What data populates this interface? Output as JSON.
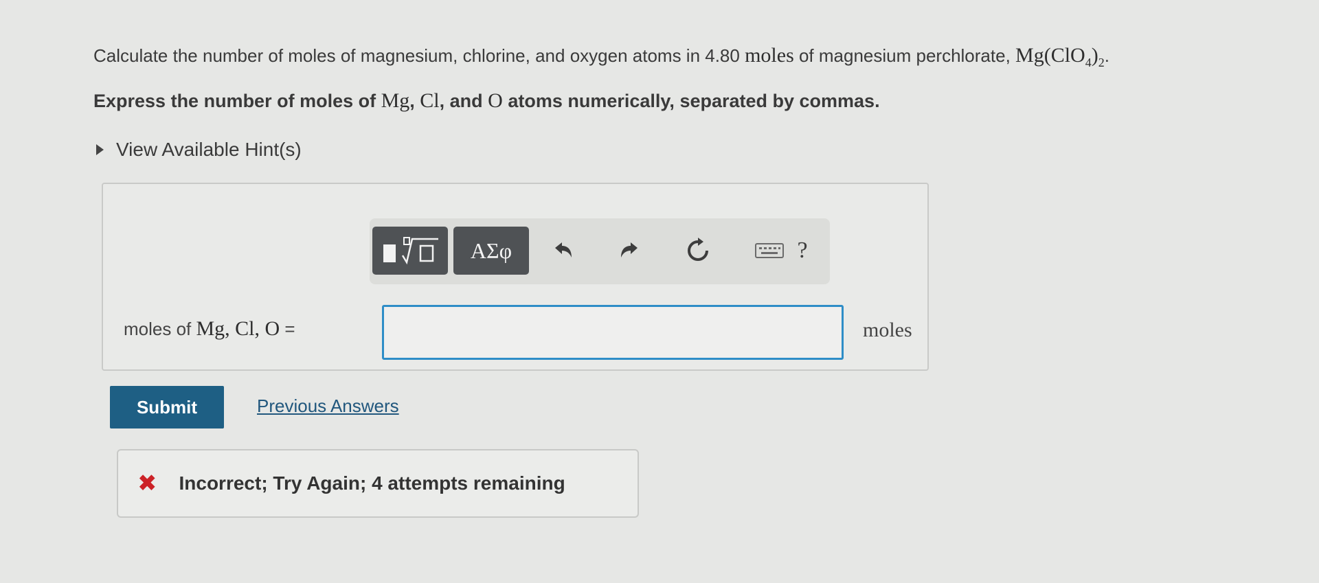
{
  "question": {
    "text": "Calculate the number of moles of magnesium, chlorine, and oxygen atoms in 4.80 ",
    "moles_unit": "moles",
    "text2": " of magnesium perchlorate, ",
    "formula_main": "Mg(ClO",
    "formula_sub4": "4",
    "formula_close": ")",
    "formula_sub2": "2",
    "end": "."
  },
  "instruction": {
    "part1": "Express the number of moles of ",
    "mg": "Mg",
    "sep1": ", ",
    "cl": "Cl",
    "sep2": ", and ",
    "o": "O",
    "part2": " atoms numerically, separated by commas."
  },
  "hint": {
    "label": "View Available Hint(s)"
  },
  "toolbar": {
    "symbols_label": "ΑΣφ",
    "help_label": "?"
  },
  "answer": {
    "label_prefix": "moles of ",
    "label_vars": "Mg,  Cl,  O",
    "label_eq": " =",
    "value": "",
    "units": "moles"
  },
  "actions": {
    "submit_label": "Submit",
    "previous_answers_label": "Previous Answers"
  },
  "feedback": {
    "icon": "x-icon",
    "message": "Incorrect; Try Again; 4 attempts remaining",
    "color": "#cc2227"
  },
  "colors": {
    "submit_bg": "#1e5f84",
    "input_border": "#2e8dc7",
    "link": "#21577d"
  }
}
